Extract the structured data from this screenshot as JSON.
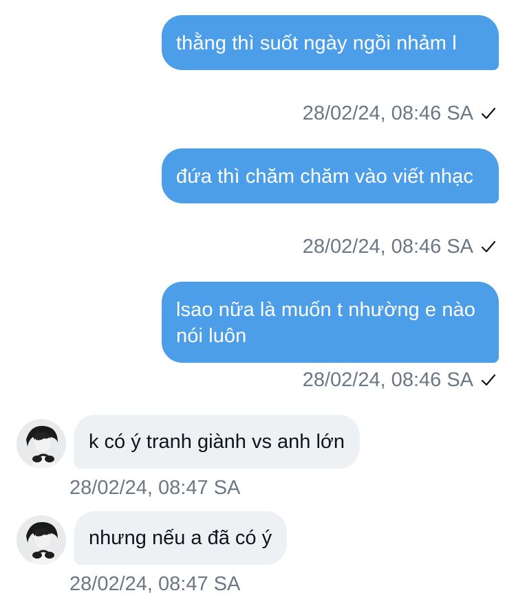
{
  "messages": [
    {
      "direction": "outgoing",
      "text": "thằng thì suốt ngày ngồi nhảm l",
      "time": "28/02/24, 08:46 SA",
      "status_icon": "check-icon"
    },
    {
      "direction": "outgoing",
      "text": "đứa thì chăm chăm vào viết nhạc",
      "time": "28/02/24, 08:46 SA",
      "status_icon": "check-icon"
    },
    {
      "direction": "outgoing",
      "text": "lsao nữa là muốn t nhường e nào nói luôn",
      "time": "28/02/24, 08:46 SA",
      "status_icon": "check-icon"
    },
    {
      "direction": "incoming",
      "text": "k có ý tranh giành vs anh lớn",
      "time": "28/02/24, 08:47 SA",
      "avatar": "avatar-image"
    },
    {
      "direction": "incoming",
      "text": "nhưng nếu a đã có ý",
      "time": "28/02/24, 08:47 SA",
      "avatar": "avatar-image"
    }
  ],
  "colors": {
    "outgoing_bubble": "#4c9ee8",
    "incoming_bubble": "#eef1f4",
    "timestamp": "#6b7785",
    "incoming_text": "#0f1419"
  }
}
